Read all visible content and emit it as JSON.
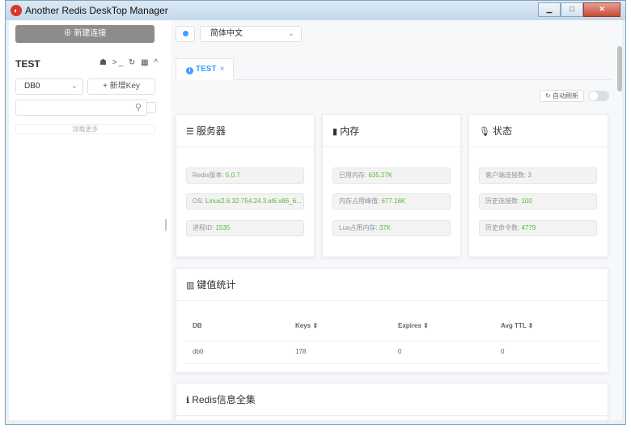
{
  "window": {
    "title": "Another Redis DeskTop Manager"
  },
  "sidebar": {
    "new_connection": "新建连接",
    "connection_name": "TEST",
    "connection_icons": "☗ >_ ↻ ▦ ^",
    "db_select": "DB0",
    "new_key": "+ 新增Key",
    "load_more": "加载更多"
  },
  "toolbar": {
    "language": "简体中文"
  },
  "tab": {
    "label": "TEST",
    "close": "×"
  },
  "auto_refresh": {
    "label": "自动刷新",
    "enabled": false
  },
  "server": {
    "title": "服务器",
    "rows": [
      {
        "label": "Redis版本: ",
        "value": "5.0.7"
      },
      {
        "label": "OS: ",
        "value": "Linux2.6.32-754.24.3.el6.x86_6..."
      },
      {
        "label": "进程ID: ",
        "value": "1535"
      }
    ]
  },
  "memory": {
    "title": "内存",
    "rows": [
      {
        "label": "已用内存: ",
        "value": "635.27K"
      },
      {
        "label": "内存占用峰值: ",
        "value": "677.16K"
      },
      {
        "label": "Lua占用内存: ",
        "value": "37K"
      }
    ]
  },
  "status": {
    "title": "状态",
    "rows": [
      {
        "label": "客户端连接数: ",
        "value": "3"
      },
      {
        "label": "历史连接数: ",
        "value": "100"
      },
      {
        "label": "历史命令数: ",
        "value": "4779"
      }
    ]
  },
  "keyspace": {
    "title": "键值统计",
    "columns": [
      "DB",
      "Keys ⇕",
      "Expires ⇕",
      "Avg TTL ⇕"
    ],
    "rows": [
      [
        "db0",
        "178",
        "0",
        "0"
      ]
    ]
  },
  "redis_info": {
    "title": "Redis信息全集"
  },
  "colors": {
    "accent": "#409eff",
    "value_green": "#58b63f",
    "new_conn_bg": "#8c8c8c"
  }
}
